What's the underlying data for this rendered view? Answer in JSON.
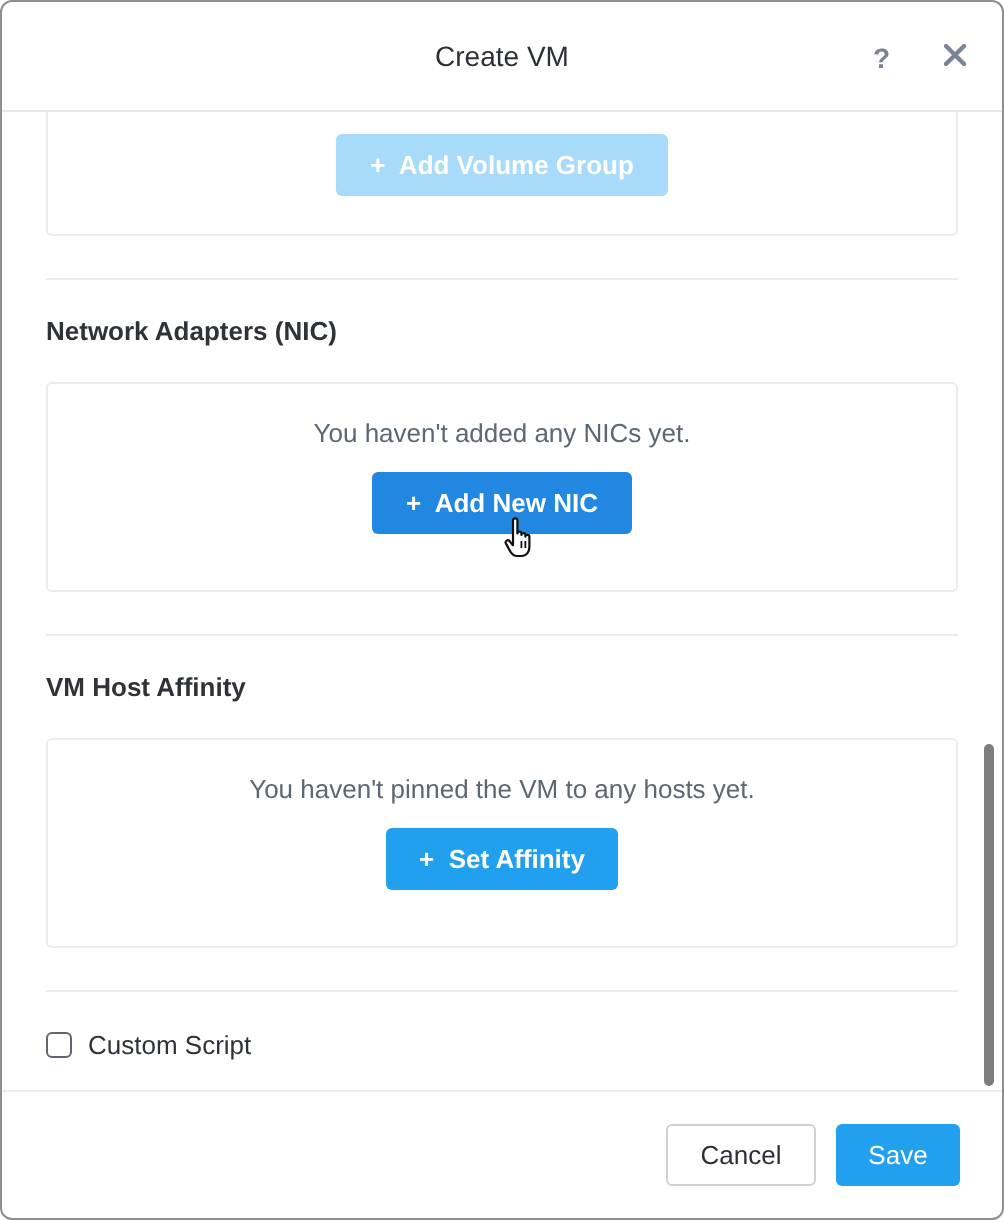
{
  "dialog": {
    "title": "Create VM",
    "help": "?"
  },
  "volume_group_button": {
    "label": "+  Add Volume Group",
    "disabled": true
  },
  "sections": [
    {
      "title": "Network Adapters (NIC)",
      "message": "You haven't added any NICs yet.",
      "button": {
        "label": "+  Add New NIC",
        "disabled": false,
        "hovered": true
      }
    },
    {
      "title": "VM Host Affinity",
      "message": "You haven't pinned the VM to any hosts yet.",
      "button": {
        "label": "+  Set Affinity",
        "disabled": false,
        "hovered": false
      }
    }
  ],
  "custom_script": {
    "label": "Custom Script",
    "checked": false
  },
  "footer_buttons": [
    {
      "label": "Cancel",
      "kind": "secondary"
    },
    {
      "label": "Save",
      "kind": "primary"
    }
  ]
}
